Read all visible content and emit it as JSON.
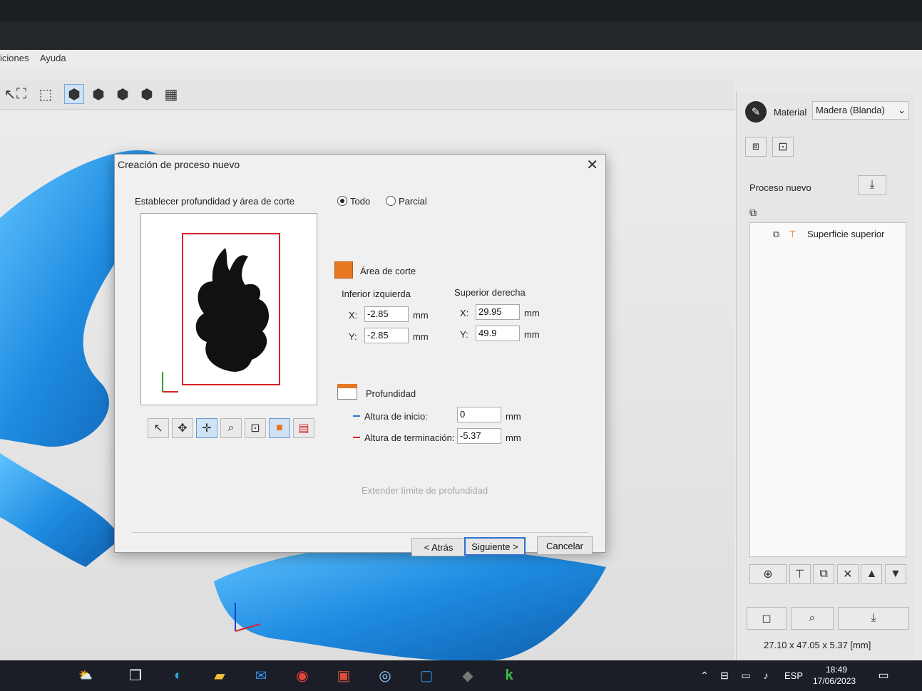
{
  "menu": {
    "item1": "iciones",
    "item2": "Ayuda"
  },
  "toolbar": {
    "icons": [
      "select-icon",
      "fit-icon",
      "zoom-region-icon",
      "view-iso-icon",
      "view-front-icon",
      "view-side-icon",
      "view-top-icon",
      "grid-view-icon"
    ]
  },
  "sidepanel": {
    "material_label": "Material",
    "material_value": "Madera (Blanda)",
    "process_label": "Proceso nuevo",
    "tree_item": "Superficie superior",
    "dimensions": "27.10 x 47.05 x 5.37 [mm]"
  },
  "dialog": {
    "title": "Creación de proceso nuevo",
    "instruction": "Establecer profundidad y área de corte",
    "radio_all": "Todo",
    "radio_partial": "Parcial",
    "cut_area_label": "Área de corte",
    "lower_left_label": "Inferior izquierda",
    "upper_right_label": "Superior derecha",
    "x_label": "X:",
    "y_label": "Y:",
    "unit": "mm",
    "lower_left_x": "-2.85",
    "lower_left_y": "-2.85",
    "upper_right_x": "29.95",
    "upper_right_y": "49.9",
    "depth_label": "Profundidad",
    "start_height_label": "Altura de inicio:",
    "start_height_value": "0",
    "end_height_label": "Altura de terminación:",
    "end_height_value": "-5.37",
    "extend_limit_label": "Extender límite de profundidad",
    "back_button": "< Atrás",
    "next_button": "Siguiente >",
    "cancel_button": "Cancelar"
  },
  "taskbar": {
    "language": "ESP",
    "time": "18:49",
    "date": "17/06/2023"
  },
  "colors": {
    "accent_blue": "#2f6fcf",
    "cut_rect_red": "#d9232a",
    "model_blue": "#1e8be0",
    "cut_area_orange": "#e87722"
  }
}
